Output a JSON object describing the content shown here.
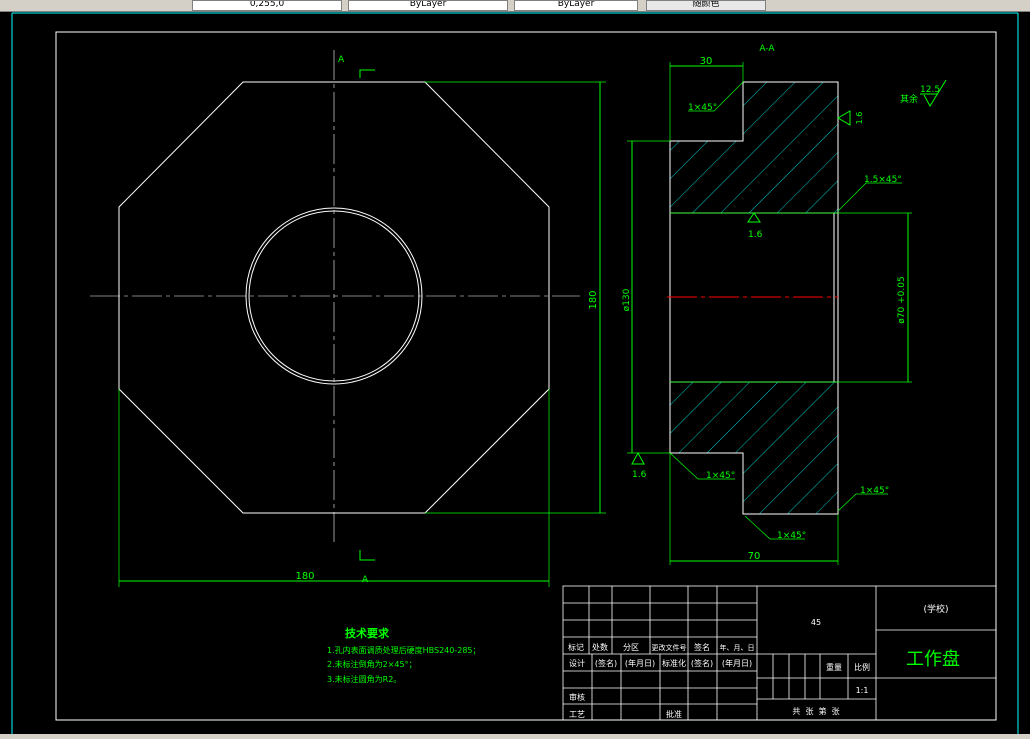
{
  "toolbar": {
    "color_value": "0,255,0",
    "linetype": "ByLayer",
    "lineweight": "ByLayer",
    "plotstyle": "随颜色"
  },
  "colors": {
    "background": "#000000",
    "geometry": "#ffffff",
    "dimension": "#00ff00",
    "hatch": "#00ffff",
    "centerline": "#ff0000"
  },
  "plan_view": {
    "section_mark_top": "A",
    "section_mark_bottom": "A",
    "dim_height": "180",
    "dim_width": "180"
  },
  "section_view": {
    "title": "A-A",
    "dim_top_width": "30",
    "dim_outer_dia": "ø130",
    "dim_bore": "ø70 +0.05",
    "dim_length": "70",
    "chamfer_top_left": "1×45°",
    "chamfer_bore": "1.5×45°",
    "chamfer_bottom_left": "1×45°",
    "chamfer_bottom_right": "1×45°",
    "chamfer_bottom": "1×45°",
    "roughness_right": "1.6",
    "roughness_bore": "1.6",
    "roughness_left": "1.6",
    "roughness_rest_label": "其余",
    "roughness_rest_value": "12.5"
  },
  "tech_requirements": {
    "title": "技术要求",
    "items": [
      "1.孔内表面调质处理后硬度HBS240-285；",
      "2.未标注倒角为2×45°；",
      "3.未标注圆角为R2。"
    ]
  },
  "title_block": {
    "material": "45",
    "school": "(学校)",
    "part_name": "工作盘",
    "headers": [
      "标记",
      "处数",
      "分区",
      "更改文件号",
      "签名",
      "年、月、日"
    ],
    "row_design": [
      "设计",
      "(签名)",
      "(年月日)",
      "标准化",
      "(签名)",
      "(年月日)"
    ],
    "review": "审核",
    "process": "工艺",
    "approve": "批准",
    "weight": "重量",
    "scale": "比例",
    "scale_value": "1:1",
    "sheets": "共  张  第  张"
  }
}
